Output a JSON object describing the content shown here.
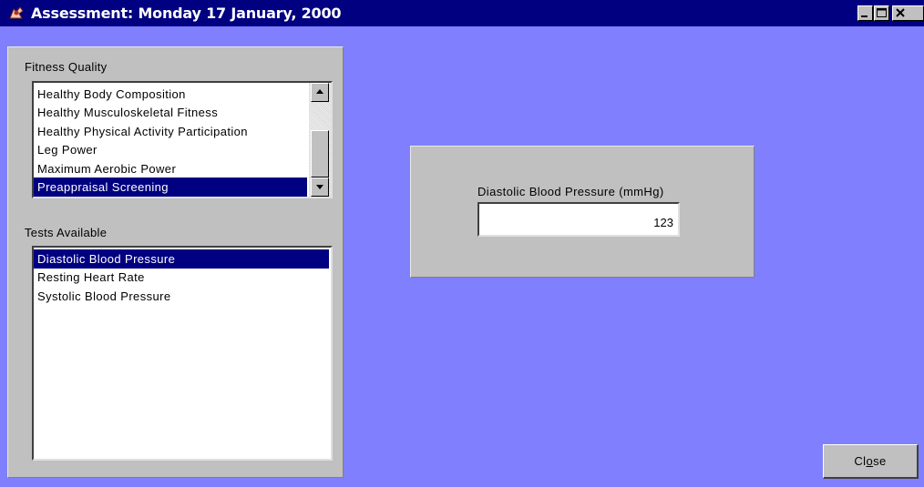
{
  "window": {
    "title": "Assessment: Monday 17 January, 2000",
    "icon": "app-icon",
    "controls": [
      "minimize-icon",
      "maximize-icon",
      "close-icon"
    ]
  },
  "fitness_quality": {
    "label": "Fitness Quality",
    "items": [
      "Healthy Body Composition",
      "Healthy Musculoskeletal Fitness",
      "Healthy Physical Activity Participation",
      "Leg Power",
      "Maximum Aerobic Power",
      "Preappraisal Screening"
    ],
    "selected": "Preappraisal Screening"
  },
  "tests_available": {
    "label": "Tests Available",
    "items": [
      "Diastolic Blood Pressure",
      "Resting Heart Rate",
      "Systolic Blood Pressure"
    ],
    "selected": "Diastolic Blood Pressure"
  },
  "measurement": {
    "label": "Diastolic Blood Pressure  (mmHg)",
    "value": "123"
  },
  "close_button": {
    "label_before": "Cl",
    "label_key": "o",
    "label_after": "se"
  },
  "colors": {
    "title_bar": "#000080",
    "workspace": "#8080ff",
    "panel": "#c0c0c0",
    "selection": "#000080"
  }
}
